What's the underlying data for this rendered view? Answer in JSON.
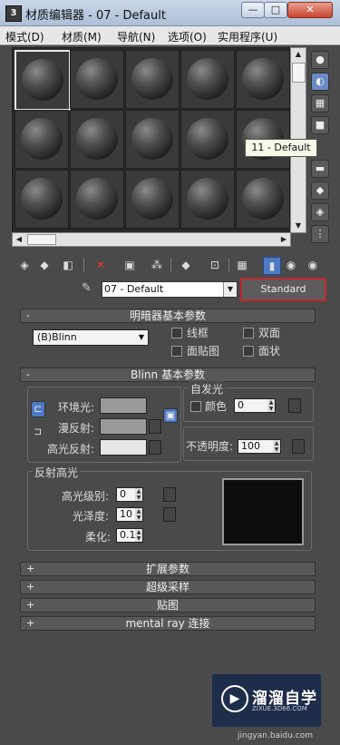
{
  "window": {
    "app_icon": "3",
    "title": "材质编辑器 - 07 - Default",
    "min": "—",
    "max": "□",
    "close": "✕"
  },
  "menu": [
    "模式(D)",
    "材质(M)",
    "导航(N)",
    "选项(O)",
    "实用程序(U)"
  ],
  "tooltip": "11 - Default",
  "material": {
    "name": "07 - Default",
    "type_button": "Standard"
  },
  "rollouts": {
    "shader_basic": {
      "sign": "-",
      "title": "明暗器基本参数"
    },
    "blinn_basic": {
      "sign": "-",
      "title": "Blinn 基本参数"
    },
    "extended": {
      "sign": "+",
      "title": "扩展参数"
    },
    "supersampling": {
      "sign": "+",
      "title": "超级采样"
    },
    "maps": {
      "sign": "+",
      "title": "贴图"
    },
    "mental_ray": {
      "sign": "+",
      "title": "mental ray 连接"
    }
  },
  "shader": {
    "type": "(B)Blinn",
    "wire": "线框",
    "two_sided": "双面",
    "face_map": "面贴图",
    "faceted": "面状"
  },
  "blinn": {
    "ambient": "环境光:",
    "diffuse": "漫反射:",
    "specular": "高光反射:",
    "self_illum_title": "自发光",
    "color": "颜色",
    "self_illum_value": "0",
    "opacity": "不透明度:",
    "opacity_value": "100",
    "colors": {
      "ambient": "#9a9a9a",
      "diffuse": "#9a9a9a",
      "specular": "#e6e6e6"
    }
  },
  "specular_highlights": {
    "title": "反射高光",
    "level_label": "高光级别:",
    "level_value": "0",
    "gloss_label": "光泽度:",
    "gloss_value": "10",
    "soften_label": "柔化:",
    "soften_value": "0.1"
  },
  "watermark": {
    "logo": "▶",
    "name": "溜溜自学",
    "url": "ZIXUE.3D66.COM",
    "source": "jingyan.baidu.com"
  },
  "colors": {
    "highlight": "#c0282c",
    "active_tool": "#4e79c4"
  }
}
